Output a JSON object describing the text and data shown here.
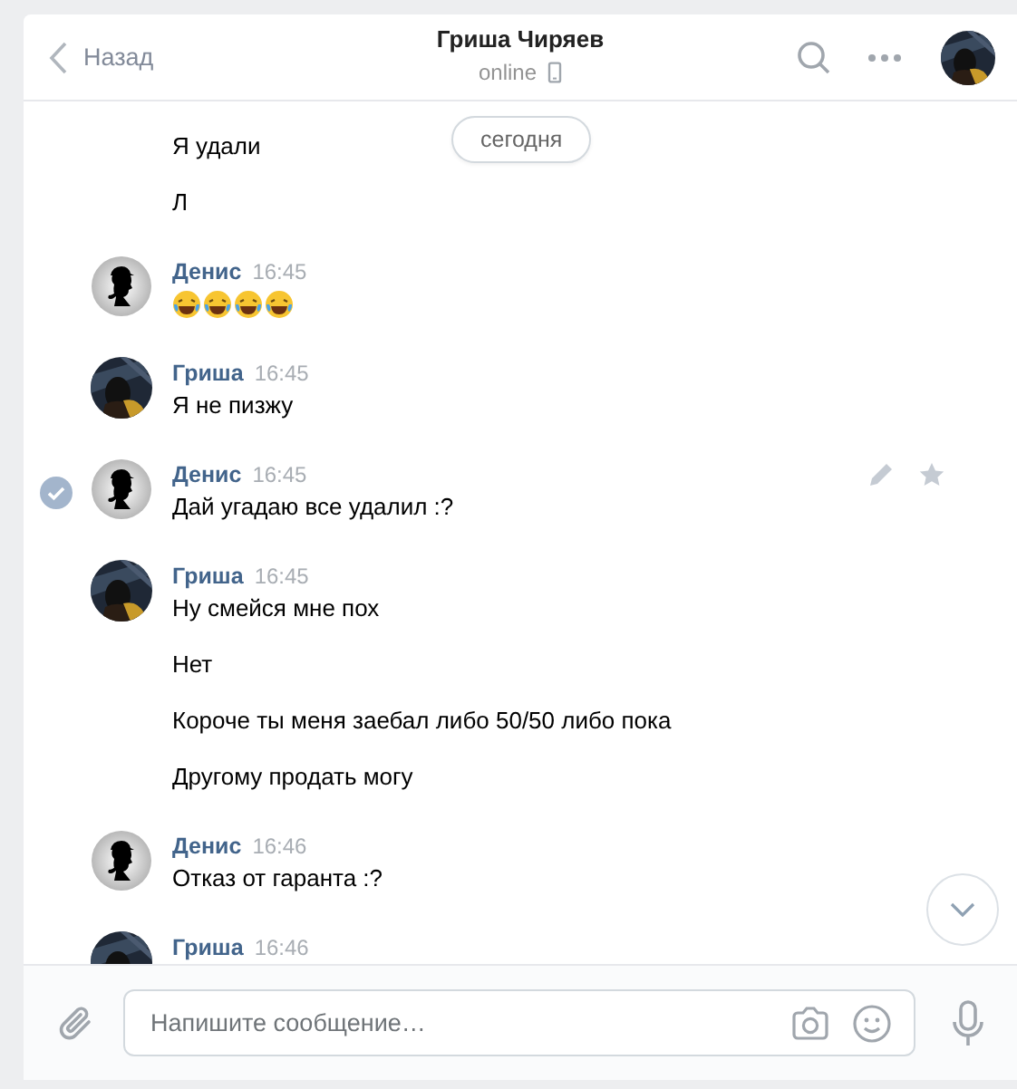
{
  "header": {
    "back": "Назад",
    "title": "Гриша Чиряев",
    "status": "online",
    "device": {
      "kind": "phone"
    },
    "avatar": {
      "kind": "photo"
    }
  },
  "date_pill": "сегодня",
  "messages_before": [
    "Я удали",
    "Л"
  ],
  "groups": [
    {
      "author": "Денис",
      "avatar": {
        "kind": "silhouette"
      },
      "time": "16:45",
      "selected": false,
      "messages": [
        {
          "kind": "emoji",
          "emoji": [
            {
              "kind": "tears-of-joy"
            },
            {
              "kind": "tears-of-joy"
            },
            {
              "kind": "tears-of-joy"
            },
            {
              "kind": "tears-of-joy"
            }
          ]
        }
      ]
    },
    {
      "author": "Гриша",
      "avatar": {
        "kind": "photo"
      },
      "time": "16:45",
      "selected": false,
      "messages": [
        {
          "kind": "text",
          "text": "Я не пизжу"
        }
      ]
    },
    {
      "author": "Денис",
      "avatar": {
        "kind": "silhouette"
      },
      "time": "16:45",
      "selected": true,
      "messages": [
        {
          "kind": "text",
          "text": "Дай угадаю все удалил :?"
        }
      ]
    },
    {
      "author": "Гриша",
      "avatar": {
        "kind": "photo"
      },
      "time": "16:45",
      "selected": false,
      "messages": [
        {
          "kind": "text",
          "text": "Ну смейся мне пох"
        },
        {
          "kind": "text",
          "text": "Нет"
        },
        {
          "kind": "text",
          "text": "Короче ты меня заебал либо 50/50 либо пока"
        },
        {
          "kind": "text",
          "text": "Другому продать могу"
        }
      ]
    },
    {
      "author": "Денис",
      "avatar": {
        "kind": "silhouette"
      },
      "time": "16:46",
      "selected": false,
      "messages": [
        {
          "kind": "text",
          "text": "Отказ от гаранта :?"
        }
      ]
    },
    {
      "author": "Гриша",
      "avatar": {
        "kind": "photo"
      },
      "time": "16:46",
      "selected": false
    }
  ],
  "composer": {
    "placeholder": "Напишите сообщение…"
  }
}
